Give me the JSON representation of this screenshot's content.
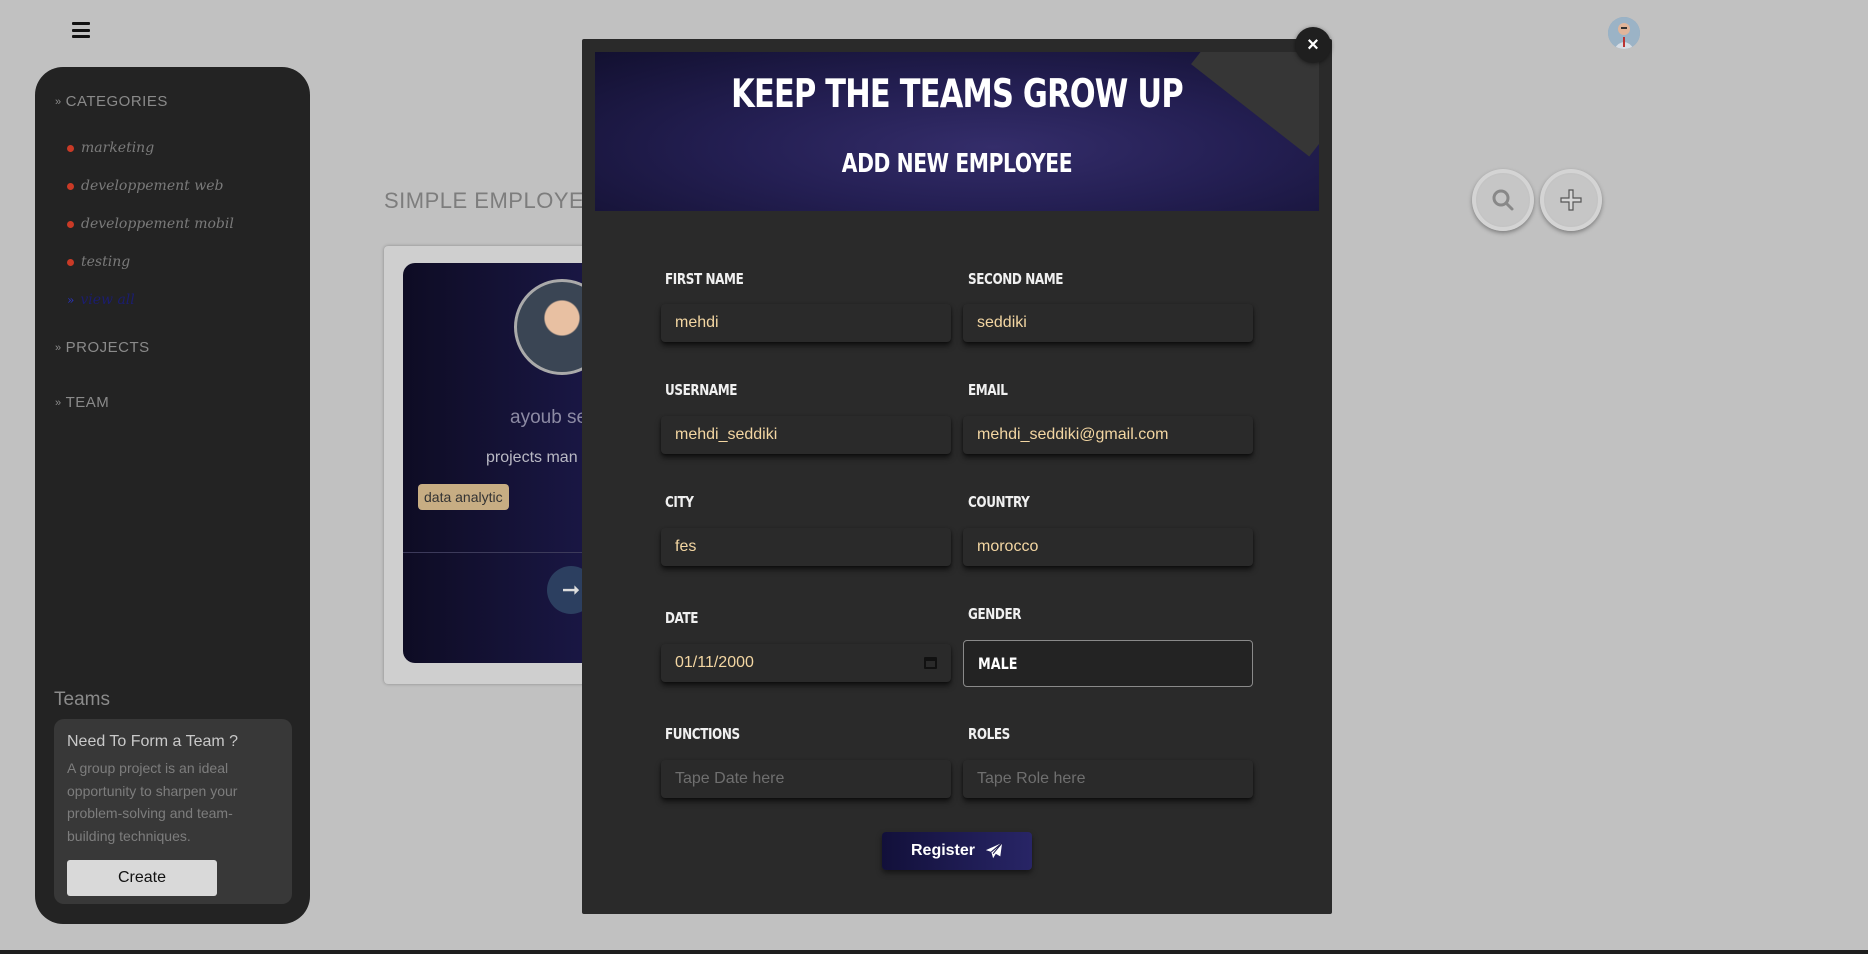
{
  "sidebar": {
    "categories_header": "CATEGORIES",
    "categories": [
      "marketing",
      "developpement web",
      "developpement mobil",
      "testing"
    ],
    "view_all": "view all",
    "projects_header": "PROJECTS",
    "team_header": "TEAM",
    "teams_title": "Teams",
    "team_card": {
      "title": "Need To Form a Team ?",
      "text": "A group project is an ideal opportunity to sharpen your problem-solving and team-building techniques.",
      "button": "Create"
    }
  },
  "main": {
    "title": "SIMPLE EMPLOYEE",
    "employee_card": {
      "name": "ayoub se",
      "role": "projects man",
      "tag": "data analytic"
    }
  },
  "modal": {
    "close": "×",
    "heading": "KEEP THE TEAMS GROW UP",
    "subheading": "ADD NEW EMPLOYEE",
    "fields": {
      "first_name": {
        "label": "FIRST NAME",
        "value": "mehdi"
      },
      "second_name": {
        "label": "SECOND NAME",
        "value": "seddiki"
      },
      "username": {
        "label": "USERNAME",
        "value": "mehdi_seddiki"
      },
      "email": {
        "label": "EMAIL",
        "value": "mehdi_seddiki@gmail.com"
      },
      "city": {
        "label": "CITY",
        "value": "fes"
      },
      "country": {
        "label": "COUNTRY",
        "value": "morocco"
      },
      "date": {
        "label": "DATE",
        "value": "01/11/2000"
      },
      "gender": {
        "label": "GENDER",
        "value": "MALE"
      },
      "functions": {
        "label": "FUNCTIONS",
        "placeholder": "Tape Date here"
      },
      "roles": {
        "label": "ROLES",
        "placeholder": "Tape Role  here"
      }
    },
    "register": "Register"
  },
  "colors": {
    "accent": "#1d1a4e",
    "input_text": "#f3d6a2",
    "category_dot": "#c93a26"
  }
}
